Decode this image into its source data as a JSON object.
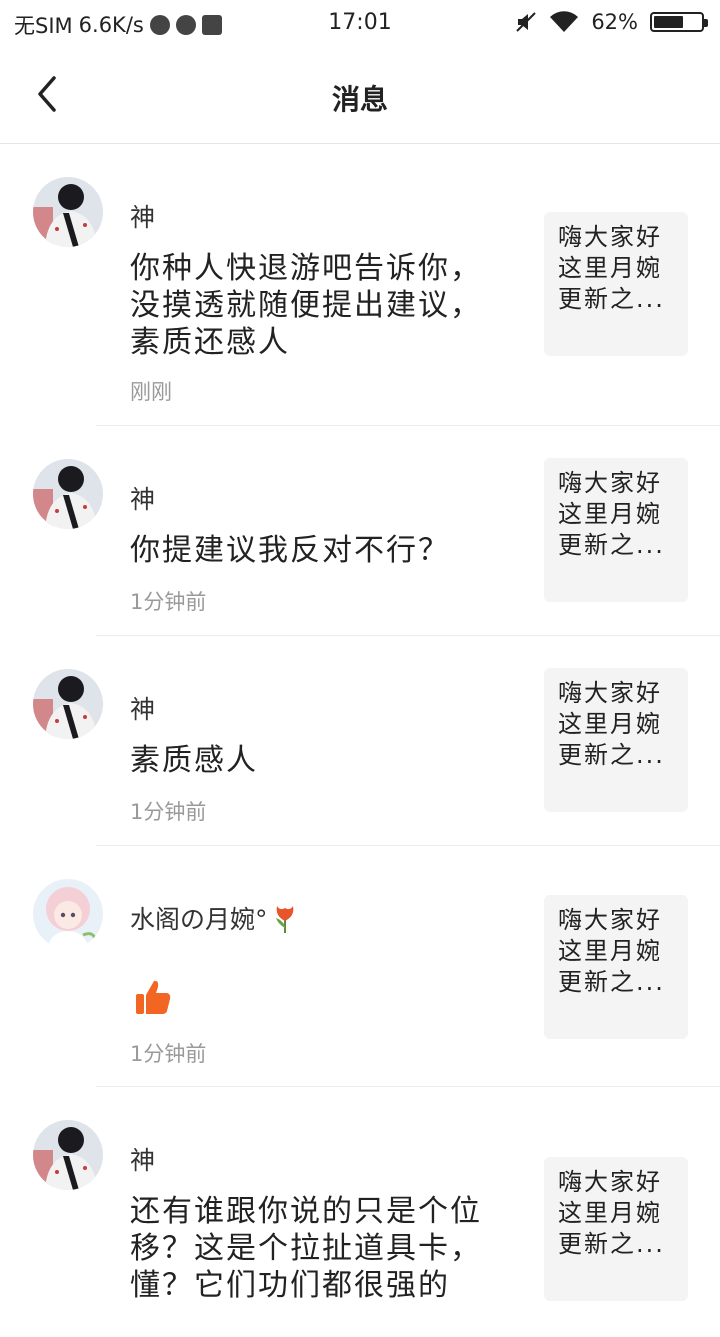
{
  "status_bar": {
    "carrier": "无SIM",
    "speed": "6.6K/s",
    "time": "17:01",
    "battery": "62%",
    "battery_level": 0.62
  },
  "header": {
    "title": "消息"
  },
  "messages": [
    {
      "name": "神",
      "content": "你种人快退游吧告诉你，没摸透就随便提出建议，素质还感人",
      "time": "刚刚",
      "preview": "嗨大家好这里月婉更新之..."
    },
    {
      "name": "神",
      "content": "你提建议我反对不行？",
      "time": "1分钟前",
      "preview": "嗨大家好这里月婉更新之..."
    },
    {
      "name": "神",
      "content": "素质感人",
      "time": "1分钟前",
      "preview": "嗨大家好这里月婉更新之..."
    },
    {
      "name": "水阁の月婉°",
      "content": "",
      "time": "1分钟前",
      "preview": "嗨大家好这里月婉更新之..."
    },
    {
      "name": "神",
      "content": "还有谁跟你说的只是个位移？这是个拉扯道具卡，懂？它们功们都很强的",
      "time": "",
      "preview": "嗨大家好这里月婉更新之..."
    }
  ],
  "icons": {
    "back": "chevron-left-icon",
    "like": "thumbs-up-icon",
    "tulip": "tulip-icon"
  },
  "colors": {
    "like": "#f26522",
    "tulip": "#e8552a"
  }
}
